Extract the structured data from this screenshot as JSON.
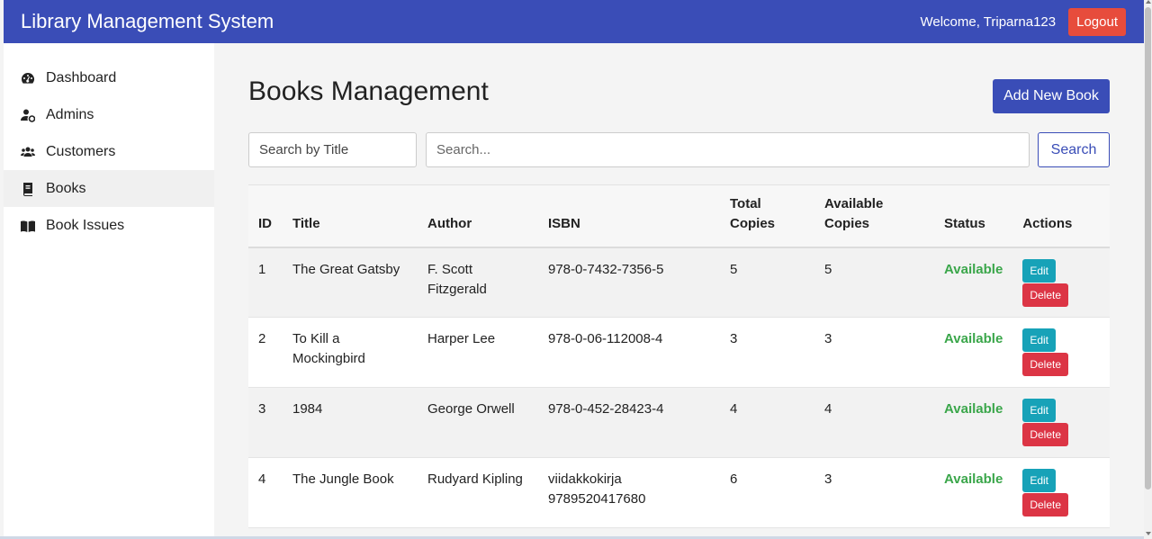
{
  "header": {
    "title": "Library Management System",
    "welcome": "Welcome, Triparna123",
    "logout_label": "Logout"
  },
  "sidebar": {
    "items": [
      {
        "label": "Dashboard",
        "icon": "tachometer-icon"
      },
      {
        "label": "Admins",
        "icon": "user-cog-icon"
      },
      {
        "label": "Customers",
        "icon": "users-icon"
      },
      {
        "label": "Books",
        "icon": "book-icon",
        "active": true
      },
      {
        "label": "Book Issues",
        "icon": "book-open-icon"
      }
    ]
  },
  "main": {
    "title": "Books Management",
    "add_label": "Add New Book",
    "search": {
      "field_selected": "Search by Title",
      "placeholder": "Search...",
      "button_label": "Search"
    },
    "table": {
      "headers": [
        "ID",
        "Title",
        "Author",
        "ISBN",
        "Total Copies",
        "Available Copies",
        "Status",
        "Actions"
      ],
      "rows": [
        {
          "id": "1",
          "title": "The Great Gatsby",
          "author": "F. Scott Fitzgerald",
          "isbn": "978-0-7432-7356-5",
          "total": "5",
          "available": "5",
          "status": "Available"
        },
        {
          "id": "2",
          "title": "To Kill a Mockingbird",
          "author": "Harper Lee",
          "isbn": "978-0-06-112008-4",
          "total": "3",
          "available": "3",
          "status": "Available"
        },
        {
          "id": "3",
          "title": "1984",
          "author": "George Orwell",
          "isbn": "978-0-452-28423-4",
          "total": "4",
          "available": "4",
          "status": "Available"
        },
        {
          "id": "4",
          "title": "The Jungle Book",
          "author": "Rudyard Kipling",
          "isbn": "viidakkokirja 9789520417680",
          "total": "6",
          "available": "3",
          "status": "Available"
        }
      ],
      "edit_label": "Edit",
      "delete_label": "Delete"
    }
  },
  "colors": {
    "primary": "#3a4db7",
    "danger": "#dc3545",
    "info": "#17a2b8",
    "success": "#3aa64a",
    "logout": "#e74c3c"
  }
}
